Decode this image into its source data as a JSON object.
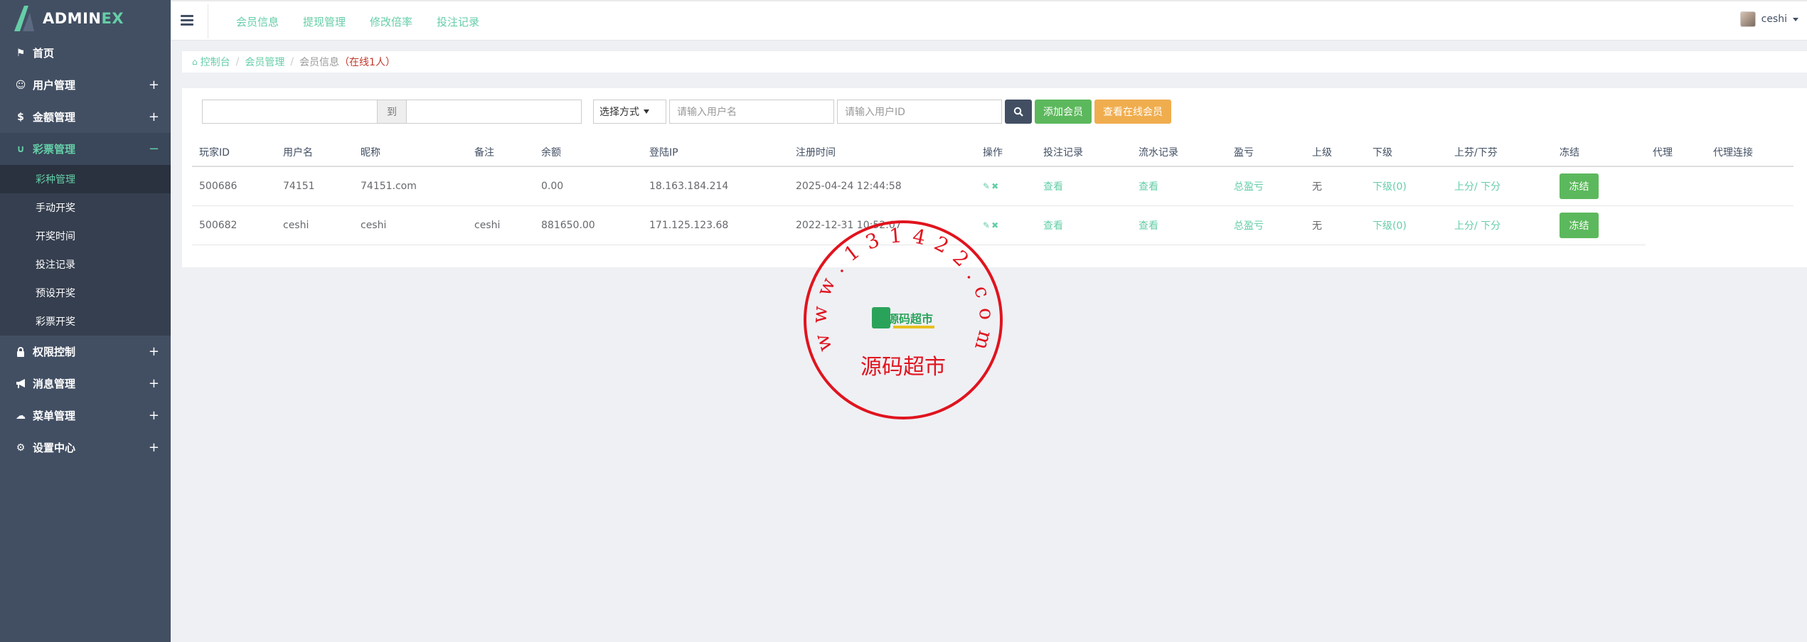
{
  "sidebar": {
    "logo_a": "ADMIN",
    "logo_b": "EX",
    "items": [
      {
        "label": "首页",
        "icon": "flag-icon",
        "glyph": "⚑",
        "expand": ""
      },
      {
        "label": "用户管理",
        "icon": "smile-icon",
        "glyph": "☺",
        "expand": "+"
      },
      {
        "label": "金额管理",
        "icon": "dollar-icon",
        "glyph": "$",
        "expand": "+"
      },
      {
        "label": "彩票管理",
        "icon": "magnet-icon",
        "glyph": "∪",
        "expand": "−"
      },
      {
        "label": "权限控制",
        "icon": "lock-icon",
        "glyph": "🔒",
        "expand": "+"
      },
      {
        "label": "消息管理",
        "icon": "bullhorn-icon",
        "glyph": "📢",
        "expand": "+"
      },
      {
        "label": "菜单管理",
        "icon": "cloud-icon",
        "glyph": "☁",
        "expand": "+"
      },
      {
        "label": "设置中心",
        "icon": "gear-icon",
        "glyph": "⚙",
        "expand": "+"
      }
    ],
    "sub_items": [
      "彩种管理",
      "手动开奖",
      "开奖时间",
      "投注记录",
      "预设开奖",
      "彩票开奖"
    ]
  },
  "header": {
    "menu": [
      "会员信息",
      "提现管理",
      "修改倍率",
      "投注记录"
    ],
    "user": "ceshi"
  },
  "breadcrumb": {
    "home": "控制台",
    "section": "会员管理",
    "current": "会员信息",
    "online": "（在线1人）"
  },
  "filters": {
    "to_label": "到",
    "select_value": "选择方式",
    "username_placeholder": "请输入用户名",
    "userid_placeholder": "请输入用户ID",
    "add_button": "添加会员",
    "online_button": "查看在线会员"
  },
  "table": {
    "headers": [
      "玩家ID",
      "用户名",
      "昵称",
      "备注",
      "余额",
      "登陆IP",
      "注册时间",
      "操作",
      "投注记录",
      "流水记录",
      "盈亏",
      "上级",
      "下级",
      "上芬/下芬",
      "冻结",
      "代理",
      "代理连接"
    ],
    "rows": [
      {
        "id": "500686",
        "username": "74151",
        "nickname": "74151.com",
        "note": "",
        "balance": "0.00",
        "ip": "18.163.184.214",
        "reg_time": "2025-04-24 12:44:58",
        "bets": "查看",
        "flow": "查看",
        "pnl": "总盈亏",
        "parent": "无",
        "children": "下级(0)",
        "updown_a": "上分",
        "updown_b": "/ 下分",
        "freeze": "冻结"
      },
      {
        "id": "500682",
        "username": "ceshi",
        "nickname": "ceshi",
        "note": "ceshi",
        "balance": "881650.00",
        "ip": "171.125.123.68",
        "reg_time": "2022-12-31 10:52:07",
        "bets": "查看",
        "flow": "查看",
        "pnl": "总盈亏",
        "parent": "无",
        "children": "下级(0)",
        "updown_a": "上分",
        "updown_b": "/ 下分",
        "freeze": "冻结"
      }
    ]
  },
  "watermark": {
    "ring_text": "w w w . 1 3 1 4 2 2 . c o m",
    "bottom_text": "源码超市",
    "logo_text": "源码超市",
    "color": "#e0141e"
  },
  "colors": {
    "sidebar": "#424f63",
    "accent": "#65cea7",
    "green": "#5cb85c",
    "orange": "#f0ad4e"
  }
}
